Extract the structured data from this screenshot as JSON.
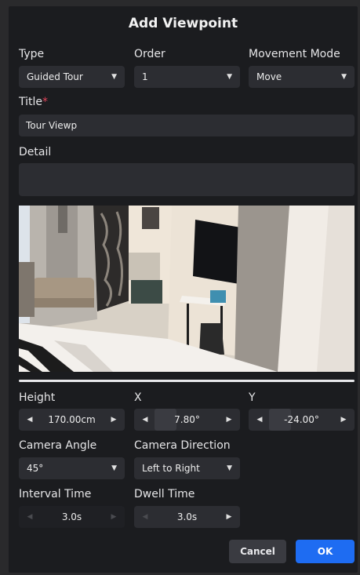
{
  "dialog": {
    "title": "Add Viewpoint",
    "type": {
      "label": "Type",
      "value": "Guided Tour"
    },
    "order": {
      "label": "Order",
      "value": "1"
    },
    "movement_mode": {
      "label": "Movement Mode",
      "value": "Move"
    },
    "title_field": {
      "label": "Title",
      "required_mark": "*",
      "value": "Tour Viewp"
    },
    "detail": {
      "label": "Detail",
      "value": ""
    },
    "height": {
      "label": "Height",
      "value": "170.00cm"
    },
    "x": {
      "label": "X",
      "value": "7.80°"
    },
    "y": {
      "label": "Y",
      "value": "-24.00°"
    },
    "camera_angle": {
      "label": "Camera Angle",
      "value": "45°"
    },
    "camera_direction": {
      "label": "Camera Direction",
      "value": "Left to Right"
    },
    "interval_time": {
      "label": "Interval Time",
      "value": "3.0s"
    },
    "dwell_time": {
      "label": "Dwell Time",
      "value": "3.0s"
    },
    "buttons": {
      "cancel": "Cancel",
      "ok": "OK"
    }
  },
  "icons": {
    "dropdown": "caret-down-icon",
    "decrement": "arrow-left-icon",
    "increment": "arrow-right-icon"
  },
  "colors": {
    "dialog_bg": "#1b1c1f",
    "field_bg": "#2c2d32",
    "accent": "#1e6cf2",
    "required": "#e0455a"
  }
}
